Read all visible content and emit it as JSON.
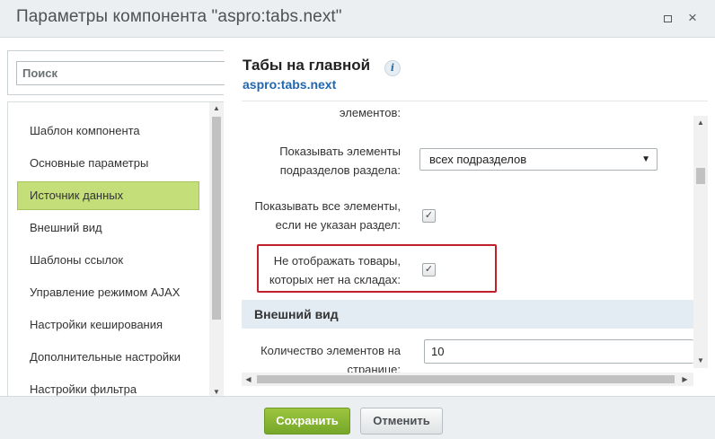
{
  "window": {
    "title": "Параметры компонента \"aspro:tabs.next\"",
    "maximize_label": "",
    "close_label": "×"
  },
  "search": {
    "placeholder": "Поиск"
  },
  "sidebar": {
    "items": [
      {
        "label": "Шаблон компонента"
      },
      {
        "label": "Основные параметры"
      },
      {
        "label": "Источник данных",
        "active": true
      },
      {
        "label": "Внешний вид"
      },
      {
        "label": "Шаблоны ссылок"
      },
      {
        "label": "Управление режимом AJAX"
      },
      {
        "label": "Настройки кеширования"
      },
      {
        "label": "Дополнительные настройки"
      },
      {
        "label": "Настройки фильтра"
      }
    ]
  },
  "component": {
    "title": "Табы на главной",
    "info_icon": "i",
    "code": "aspro:tabs.next"
  },
  "properties": {
    "cut_label": "элементов:",
    "show_subsection_elements": {
      "label_line1": "Показывать элементы",
      "label_line2": "подразделов раздела:",
      "value": "всех подразделов"
    },
    "show_all_elements": {
      "label_line1": "Показывать все элементы,",
      "label_line2": "если не указан раздел:",
      "checked": true
    },
    "hide_not_available": {
      "label_line1": "Не отображать товары,",
      "label_line2": "которых нет на складах:",
      "checked": true
    },
    "section_appearance": "Внешний вид",
    "page_element_count": {
      "label_line1": "Количество элементов на",
      "label_line2": "странице:",
      "value": "10"
    }
  },
  "footer": {
    "save_label": "Сохранить",
    "cancel_label": "Отменить"
  },
  "colors": {
    "active_nav": "#c4df7a",
    "save_button": "#8ab834",
    "highlight_border": "#c0202c",
    "section_bg": "#e3ecf3",
    "code_link": "#2067b0"
  },
  "icons": {
    "maximize": "maximize-icon",
    "close": "close-icon",
    "info": "info-icon",
    "checkbox": "checkmark-icon",
    "caret": "chevron-down-icon"
  }
}
